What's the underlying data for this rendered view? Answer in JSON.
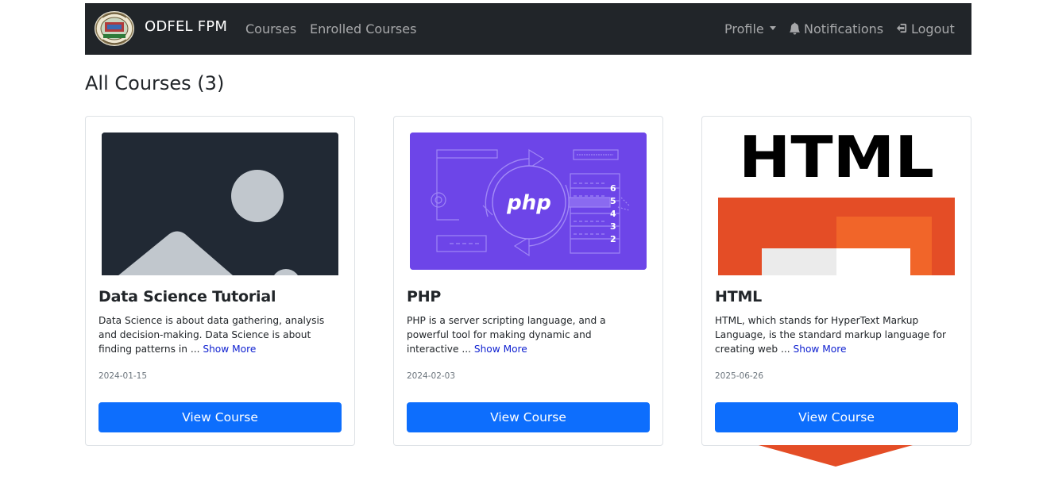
{
  "nav": {
    "brand": "ODFEL FPM",
    "links": [
      "Courses",
      "Enrolled Courses"
    ],
    "profile": "Profile",
    "notifications": "Notifications",
    "logout": "Logout"
  },
  "page": {
    "title": "All Courses (3)"
  },
  "courses": [
    {
      "title": "Data Science Tutorial",
      "description": "Data Science is about data gathering, analysis and decision-making. Data Science is about finding patterns in ...",
      "show_more": "Show More",
      "date": "2024-01-15",
      "button": "View Course",
      "image": "placeholder-image"
    },
    {
      "title": "PHP",
      "description": "PHP is a server scripting language, and a powerful tool for making dynamic and interactive ...",
      "show_more": "Show More",
      "date": "2024-02-03",
      "button": "View Course",
      "image": "php-illustration",
      "image_text": "php",
      "image_numbers": [
        "6",
        "5",
        "4",
        "3",
        "2"
      ]
    },
    {
      "title": "HTML",
      "description": "HTML, which stands for HyperText Markup Language, is the standard markup language for creating web ...",
      "show_more": "Show More",
      "date": "2025-06-26",
      "button": "View Course",
      "image": "html5-logo",
      "image_text": "HTML"
    }
  ],
  "colors": {
    "navbar": "#212529",
    "primary": "#0d6efd",
    "link": "#0d1fd0",
    "php_bg": "#6d45e8",
    "html_orange": "#e44d26"
  }
}
